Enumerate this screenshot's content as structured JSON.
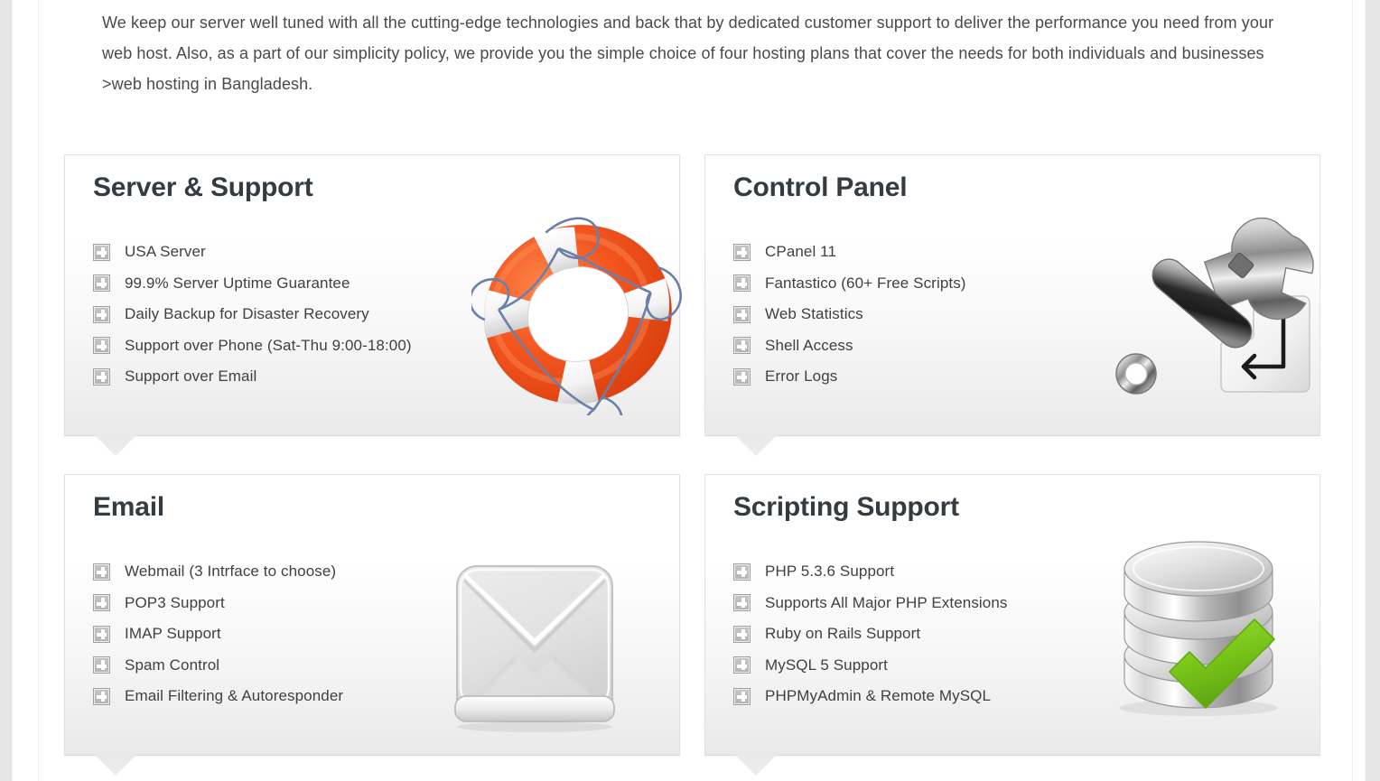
{
  "intro": {
    "paragraph": "We keep our server well tuned with all the cutting-edge technologies and back that by dedicated customer support to deliver the performance you need from your web host. Also, as a part of our simplicity policy, we provide you the simple choice of four hosting plans that cover the needs for both individuals and businesses >web hosting in Bangladesh."
  },
  "colors": {
    "heading": "#343b41",
    "body_text": "#4a4a4a",
    "panel_border": "#e2e2e2",
    "panel_bg_top": "#ffffff",
    "panel_bg_bottom": "#e9e9e9",
    "page_bg": "#e6e6e6",
    "buoy_orange": "#f4561f",
    "buoy_rope_blue": "#6b7fa8",
    "check_green": "#7ac719",
    "metal_gray": "#c9c9c9"
  },
  "panels": [
    {
      "id": "server-support",
      "title": "Server & Support",
      "icon": "lifebuoy-icon",
      "items": [
        "USA Server",
        "99.9% Server Uptime Guarantee",
        "Daily Backup for Disaster Recovery",
        "Support over Phone (Sat-Thu 9:00-18:00)",
        "Support over Email"
      ]
    },
    {
      "id": "control-panel",
      "title": "Control Panel",
      "icon": "wrench-icon",
      "items": [
        "CPanel 11",
        "Fantastico (60+ Free Scripts)",
        "Web Statistics",
        "Shell Access",
        "Error Logs"
      ]
    },
    {
      "id": "email",
      "title": "Email",
      "icon": "envelope-icon",
      "items": [
        "Webmail (3 Intrface to choose)",
        "POP3 Support",
        "IMAP Support",
        "Spam Control",
        "Email Filtering & Autoresponder"
      ]
    },
    {
      "id": "scripting-support",
      "title": "Scripting Support",
      "icon": "database-check-icon",
      "items": [
        "PHP 5.3.6 Support",
        "Supports All Major PHP Extensions",
        "Ruby on Rails Support",
        "MySQL 5 Support",
        "PHPMyAdmin & Remote MySQL"
      ]
    }
  ]
}
